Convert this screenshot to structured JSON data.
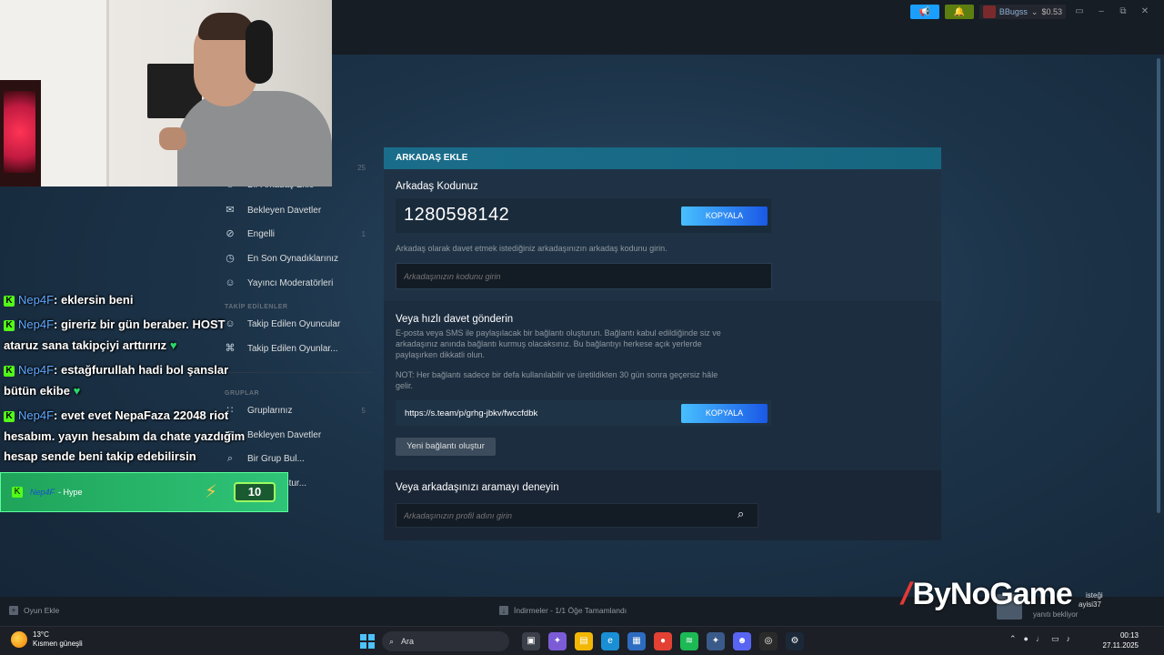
{
  "top_bar": {
    "username": "BBugss",
    "balance": "$0.53"
  },
  "sidebar": {
    "items": [
      {
        "label": "Bir Arkadaş Ekle",
        "count": "25"
      },
      {
        "label": "Bekleyen Davetler",
        "count": ""
      },
      {
        "label": "Engelli",
        "count": "1"
      },
      {
        "label": "En Son Oynadıklarınız",
        "count": ""
      },
      {
        "label": "Yayıncı Moderatörleri",
        "count": ""
      }
    ],
    "followed_header": "TAKİP EDİLENLER",
    "followed_items": [
      {
        "label": "Takip Edilen Oyuncular"
      },
      {
        "label": "Takip Edilen Oyunlar..."
      }
    ],
    "groups_header": "GRUPLAR",
    "group_items": [
      {
        "label": "Gruplarınız",
        "count": "5"
      },
      {
        "label": "Bekleyen Davetler",
        "count": ""
      },
      {
        "label": "Bir Grup Bul...",
        "count": ""
      },
      {
        "label": "Grup Oluştur...",
        "count": ""
      }
    ]
  },
  "panel": {
    "header": "ARKADAŞ EKLE",
    "code_title": "Arkadaş Kodunuz",
    "friend_code": "1280598142",
    "copy_label": "KOPYALA",
    "code_desc": "Arkadaş olarak davet etmek istediğiniz arkadaşınızın arkadaş kodunu girin.",
    "code_placeholder": "Arkadaşınızın kodunu girin",
    "link_title": "Veya hızlı davet gönderin",
    "link_desc_1": "E-posta veya SMS ile paylaşılacak bir bağlantı oluşturun. Bağlantı kabul edildiğinde siz ve",
    "link_desc_2": "arkadaşınız anında bağlantı kurmuş olacaksınız. Bu bağlantıyı herkese açık yerlerde",
    "link_desc_3": "paylaşırken dikkatli olun.",
    "link_note_1": "NOT: Her bağlantı sadece bir defa kullanılabilir ve üretildikten 30 gün sonra geçersiz hâle",
    "link_note_2": "gelir.",
    "invite_link": "https://s.team/p/grhg-jbkv/fwccfdbk",
    "new_link_label": "Yeni bağlantı oluştur",
    "search_title": "Veya arkadaşınızı aramayı deneyin",
    "search_placeholder": "Arkadaşınızın profil adını girin"
  },
  "bottom_bar": {
    "add_game": "Oyun Ekle",
    "downloads": "İndirmeler - 1/1 Öğe Tamamlandı"
  },
  "chat": {
    "lines": [
      {
        "user": "Nep4F",
        "text": ": eklersin beni"
      },
      {
        "user": "Nep4F",
        "text": ": gireriz bir gün beraber. HOST"
      },
      {
        "user": "",
        "text": "ataruz sana takipçiyi arttırırız"
      },
      {
        "user": "Nep4F",
        "text": ": estağfurullah hadi bol şanslar"
      },
      {
        "user": "",
        "text": "bütün ekibe"
      },
      {
        "user": "Nep4F",
        "text": ": evet evet NepaFaza 22048 riot"
      },
      {
        "user": "",
        "text": "hesabım. yayın hesabım da chate yazdığım"
      },
      {
        "user": "",
        "text": "hesap sende beni takip edebilirsin"
      }
    ],
    "hype": {
      "user": "Nep4F",
      "label": "- Hype",
      "count": "10"
    }
  },
  "overlay": {
    "logo": "ByNoGame",
    "friend_popup_1": "isteği",
    "friend_popup_2": "ayisi37",
    "friend_popup_3": "yanıtı bekliyor"
  },
  "taskbar": {
    "temp": "13°C",
    "weather": "Kısmen güneşli",
    "search": "Ara",
    "time": "00:13",
    "date": "27.11.2025"
  }
}
